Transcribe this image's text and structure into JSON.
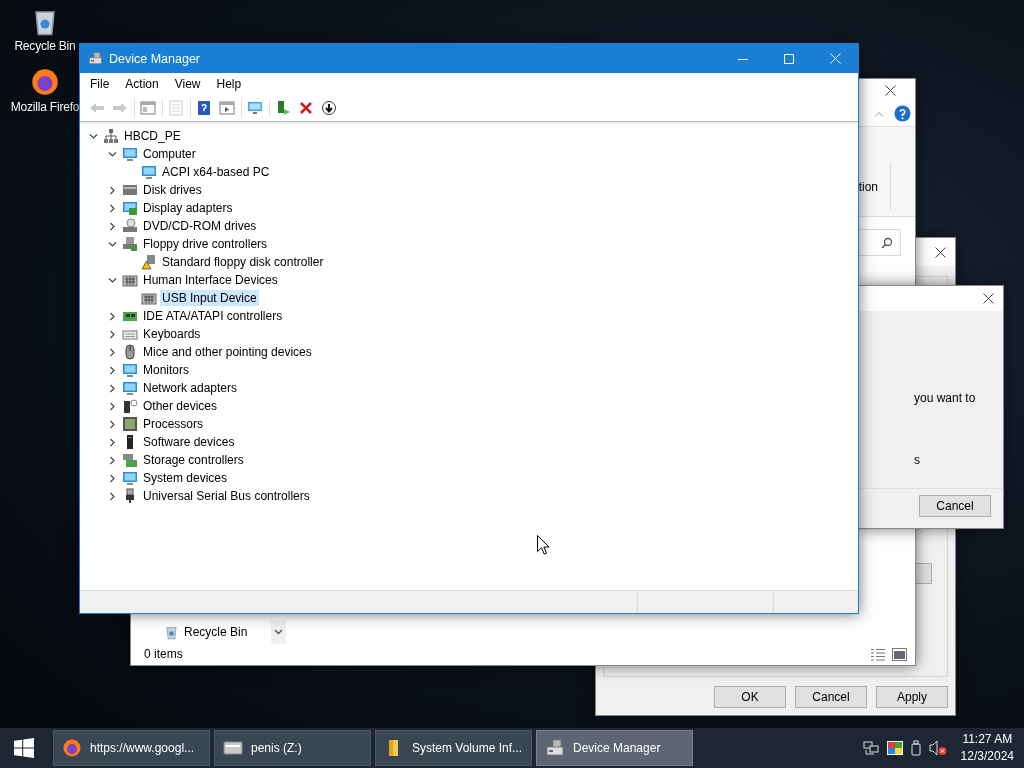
{
  "desktop_icons": [
    {
      "kind": "recycle-bin",
      "label": "Recycle Bin"
    },
    {
      "kind": "browser",
      "label": "Mozilla Firefo"
    }
  ],
  "background_windows": [
    {
      "kind": "properties",
      "buttons": [
        "OK",
        "Cancel",
        "Apply"
      ]
    },
    {
      "kind": "explorer",
      "ribbon_text": "tion",
      "nav_item": "Recycle Bin",
      "status": "0 items"
    },
    {
      "kind": "confirm",
      "lines": [
        "you want to",
        "s"
      ],
      "buttons": [
        "Cancel"
      ]
    }
  ],
  "device_manager": {
    "title": "Device Manager",
    "menu": [
      "File",
      "Action",
      "View",
      "Help"
    ],
    "toolbar": [
      {
        "buttons": [
          {
            "kind": "back",
            "disabled": true
          },
          {
            "kind": "forward",
            "disabled": true
          }
        ]
      },
      {
        "buttons": [
          {
            "kind": "properties",
            "disabled": false
          }
        ]
      },
      {
        "buttons": [
          {
            "kind": "sheet",
            "disabled": true
          }
        ]
      },
      {
        "buttons": [
          {
            "kind": "help",
            "disabled": false
          },
          {
            "kind": "run-window",
            "disabled": false
          }
        ]
      },
      {
        "buttons": [
          {
            "kind": "scan",
            "disabled": false
          }
        ]
      },
      {
        "buttons": [
          {
            "kind": "update-driver",
            "disabled": false
          },
          {
            "kind": "uninstall",
            "disabled": false
          },
          {
            "kind": "disable",
            "disabled": false
          }
        ]
      }
    ],
    "tree": [
      {
        "label": "HBCD_PE",
        "kind": "network",
        "expanded": true,
        "selected": false,
        "children": [
          {
            "label": "Computer",
            "kind": "monitor",
            "expanded": true,
            "selected": false,
            "children": [
              {
                "label": "ACPI x64-based PC",
                "kind": "monitor",
                "selected": false
              }
            ]
          },
          {
            "label": "Disk drives",
            "kind": "drive",
            "expanded": false,
            "selected": false
          },
          {
            "label": "Display adapters",
            "kind": "display",
            "expanded": false,
            "selected": false
          },
          {
            "label": "DVD/CD-ROM drives",
            "kind": "disc",
            "expanded": false,
            "selected": false
          },
          {
            "label": "Floppy drive controllers",
            "kind": "floppy",
            "expanded": true,
            "selected": false,
            "children": [
              {
                "label": "Standard floppy disk controller",
                "kind": "warning-drive",
                "selected": false
              }
            ]
          },
          {
            "label": "Human Interface Devices",
            "kind": "keypad",
            "expanded": true,
            "selected": false,
            "children": [
              {
                "label": "USB Input Device",
                "kind": "keypad",
                "selected": true
              }
            ]
          },
          {
            "label": "IDE ATA/ATAPI controllers",
            "kind": "card",
            "expanded": false,
            "selected": false
          },
          {
            "label": "Keyboards",
            "kind": "keyboard",
            "expanded": false,
            "selected": false
          },
          {
            "label": "Mice and other pointing devices",
            "kind": "mouse",
            "expanded": false,
            "selected": false
          },
          {
            "label": "Monitors",
            "kind": "monitor",
            "expanded": false,
            "selected": false
          },
          {
            "label": "Network adapters",
            "kind": "monitor",
            "expanded": false,
            "selected": false
          },
          {
            "label": "Other devices",
            "kind": "unknown",
            "expanded": false,
            "selected": false
          },
          {
            "label": "Processors",
            "kind": "chip",
            "expanded": false,
            "selected": false
          },
          {
            "label": "Software devices",
            "kind": "tower",
            "expanded": false,
            "selected": false
          },
          {
            "label": "Storage controllers",
            "kind": "storage",
            "expanded": false,
            "selected": false
          },
          {
            "label": "System devices",
            "kind": "monitor",
            "expanded": false,
            "selected": false
          },
          {
            "label": "Universal Serial Bus controllers",
            "kind": "usb",
            "expanded": false,
            "selected": false
          }
        ]
      }
    ]
  },
  "taskbar": {
    "items": [
      {
        "kind": "browser",
        "label": "https://www.googl...",
        "selected": false
      },
      {
        "kind": "drive",
        "label": "penis (Z:)",
        "selected": false
      },
      {
        "kind": "folder",
        "label": "System Volume Inf...",
        "selected": false
      },
      {
        "kind": "device-manager",
        "label": "Device Manager",
        "selected": true
      }
    ],
    "time": "11:27 AM",
    "date": "12/3/2024"
  }
}
